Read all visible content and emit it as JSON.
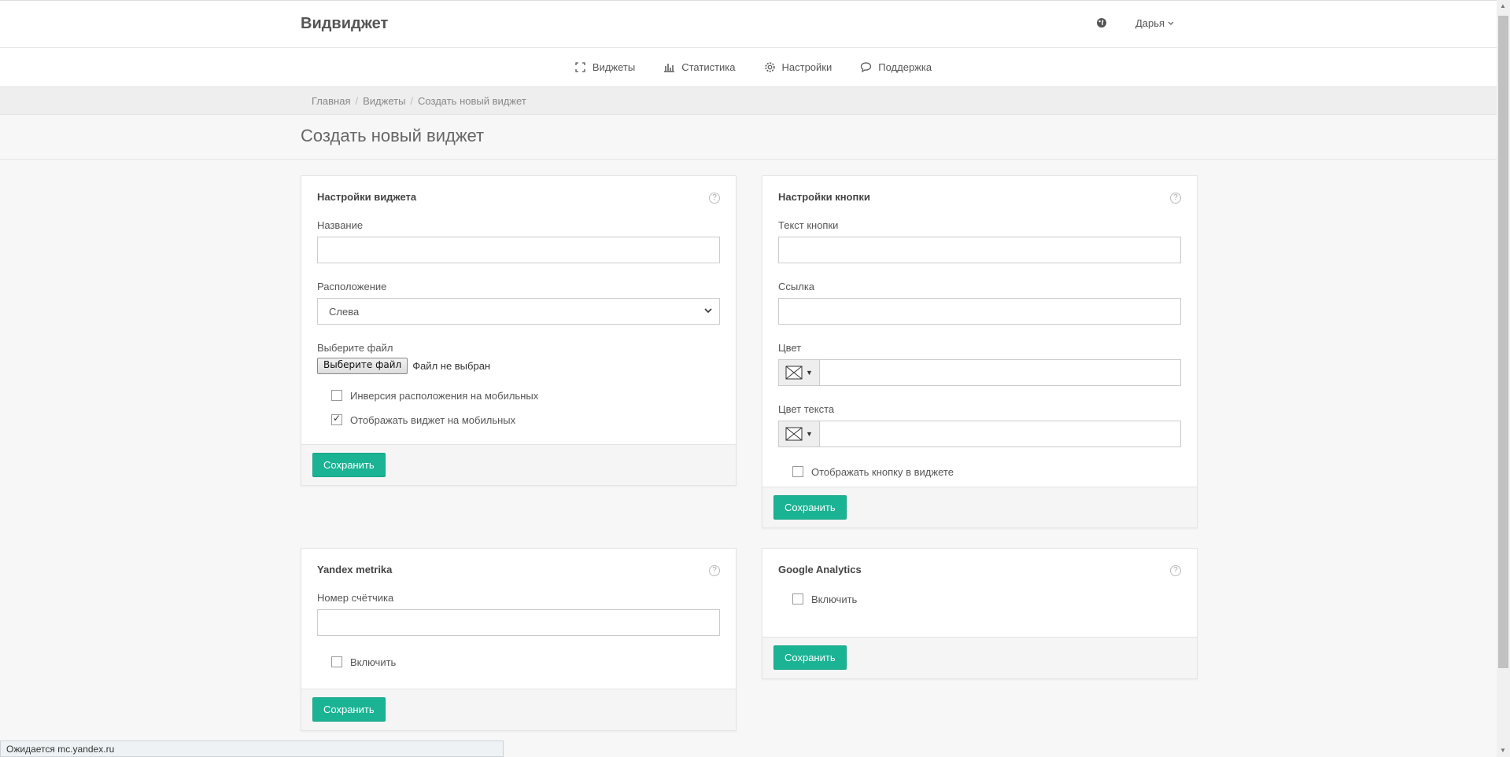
{
  "brand": "Видвиджет",
  "user": {
    "name": "Дарья"
  },
  "nav": [
    {
      "label": "Виджеты",
      "icon": "expand-icon"
    },
    {
      "label": "Статистика",
      "icon": "bar-chart-icon"
    },
    {
      "label": "Настройки",
      "icon": "gear-icon"
    },
    {
      "label": "Поддержка",
      "icon": "chat-icon"
    }
  ],
  "breadcrumb": [
    "Главная",
    "Виджеты",
    "Создать новый виджет"
  ],
  "page_title": "Создать новый виджет",
  "widget_settings": {
    "title": "Настройки виджета",
    "name_label": "Название",
    "name_value": "",
    "position_label": "Расположение",
    "position_value": "Слева",
    "file_label": "Выберите файл",
    "file_button": "Выберите файл",
    "file_status": "Файл не выбран",
    "invert_label": "Инверсия расположения на мобильных",
    "invert_checked": false,
    "mobile_label": "Отображать виджет на мобильных",
    "mobile_checked": true,
    "save": "Сохранить"
  },
  "button_settings": {
    "title": "Настройки кнопки",
    "text_label": "Текст кнопки",
    "text_value": "",
    "link_label": "Ссылка",
    "link_value": "",
    "color_label": "Цвет",
    "color_value": "",
    "text_color_label": "Цвет текста",
    "text_color_value": "",
    "show_label": "Отображать кнопку в виджете",
    "show_checked": false,
    "save": "Сохранить"
  },
  "yandex": {
    "title": "Yandex metrika",
    "counter_label": "Номер счётчика",
    "counter_value": "",
    "enable_label": "Включить",
    "enable_checked": false,
    "save": "Сохранить"
  },
  "google": {
    "title": "Google Analytics",
    "enable_label": "Включить",
    "enable_checked": false,
    "save": "Сохранить"
  },
  "status_bar": "Ожидается mc.yandex.ru",
  "colors": {
    "accent": "#1ab394",
    "header_bg": "#ffffff",
    "page_bg": "#f7f7f7"
  }
}
